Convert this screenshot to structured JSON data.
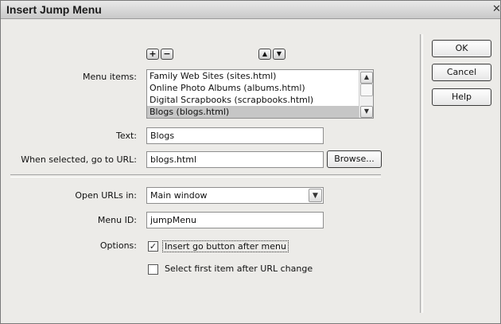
{
  "dialog": {
    "title": "Insert Jump Menu",
    "close_glyph": "✕"
  },
  "toolbar": {
    "add_icon": "plus-icon",
    "remove_icon": "minus-icon",
    "up_icon": "arrow-up-icon",
    "down_icon": "arrow-down-icon",
    "add_glyph": "+",
    "remove_glyph": "−",
    "up_glyph": "▲",
    "down_glyph": "▼"
  },
  "menu_items": {
    "label": "Menu items:",
    "items": [
      "Family Web Sites (sites.html)",
      "Online Photo Albums (albums.html)",
      "Digital Scrapbooks (scrapbooks.html)",
      "Blogs (blogs.html)"
    ],
    "selected_index": 3
  },
  "text_field": {
    "label": "Text:",
    "value": "Blogs"
  },
  "url_field": {
    "label": "When selected, go to URL:",
    "value": "blogs.html",
    "browse_label": "Browse..."
  },
  "open_urls": {
    "label": "Open URLs in:",
    "value": "Main window"
  },
  "menu_id": {
    "label": "Menu ID:",
    "value": "jumpMenu"
  },
  "options": {
    "label": "Options:",
    "go_button": {
      "label": "Insert go button after menu",
      "checked": true
    },
    "select_first": {
      "label": "Select first item after URL change",
      "checked": false
    }
  },
  "buttons": {
    "ok": "OK",
    "cancel": "Cancel",
    "help": "Help"
  },
  "colors": {
    "dialog_bg": "#ecebe8",
    "selection": "#c6c6c6"
  }
}
